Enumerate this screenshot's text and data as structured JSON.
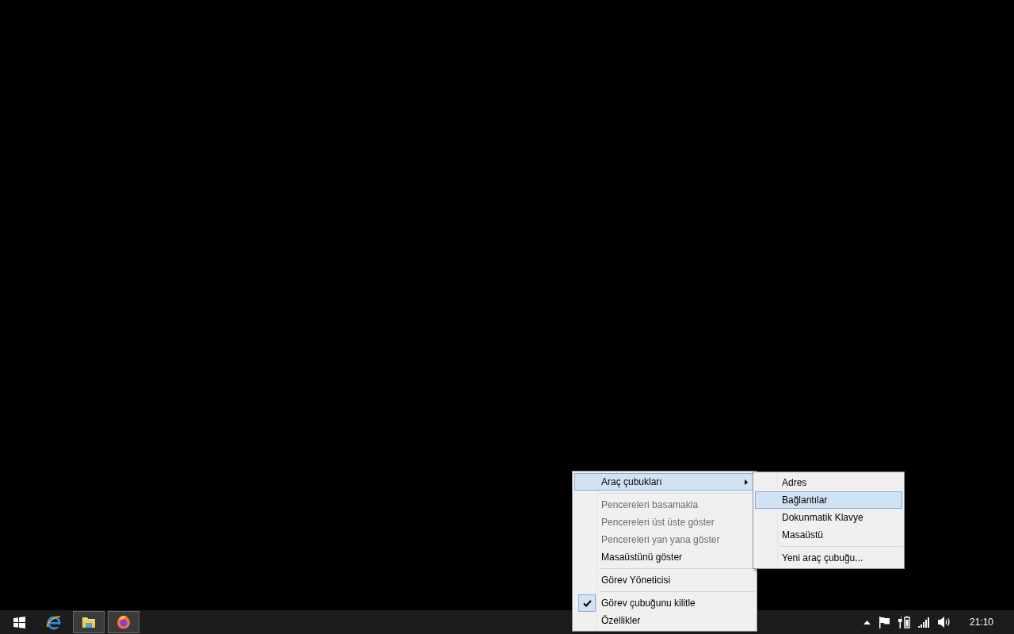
{
  "context_menu": {
    "items": [
      {
        "kind": "item",
        "label": "Araç çubukları",
        "selected": true,
        "disabled": false,
        "checked": false,
        "submenu": true
      },
      {
        "kind": "separator"
      },
      {
        "kind": "item",
        "label": "Pencereleri basamakla",
        "selected": false,
        "disabled": true,
        "checked": false,
        "submenu": false
      },
      {
        "kind": "item",
        "label": "Pencereleri üst üste göster",
        "selected": false,
        "disabled": true,
        "checked": false,
        "submenu": false
      },
      {
        "kind": "item",
        "label": "Pencereleri yan yana göster",
        "selected": false,
        "disabled": true,
        "checked": false,
        "submenu": false
      },
      {
        "kind": "item",
        "label": "Masaüstünü göster",
        "selected": false,
        "disabled": false,
        "checked": false,
        "submenu": false
      },
      {
        "kind": "separator"
      },
      {
        "kind": "item",
        "label": "Görev Yöneticisi",
        "selected": false,
        "disabled": false,
        "checked": false,
        "submenu": false
      },
      {
        "kind": "separator"
      },
      {
        "kind": "item",
        "label": "Görev çubuğunu kilitle",
        "selected": false,
        "disabled": false,
        "checked": true,
        "submenu": false
      },
      {
        "kind": "item",
        "label": "Özellikler",
        "selected": false,
        "disabled": false,
        "checked": false,
        "submenu": false
      }
    ]
  },
  "submenu": {
    "items": [
      {
        "kind": "item",
        "label": "Adres",
        "selected": false
      },
      {
        "kind": "item",
        "label": "Bağlantılar",
        "selected": true
      },
      {
        "kind": "item",
        "label": "Dokunmatik Klavye",
        "selected": false
      },
      {
        "kind": "item",
        "label": "Masaüstü",
        "selected": false
      },
      {
        "kind": "separator"
      },
      {
        "kind": "item",
        "label": "Yeni araç çubuğu...",
        "selected": false
      }
    ]
  },
  "taskbar": {
    "apps": [
      {
        "kind": "start",
        "running": false
      },
      {
        "kind": "browser-e",
        "running": false
      },
      {
        "kind": "folder",
        "running": true
      },
      {
        "kind": "browser-fox",
        "running": true
      }
    ],
    "clock": "21:10"
  }
}
